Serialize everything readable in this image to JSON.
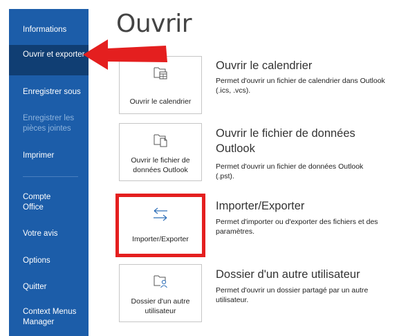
{
  "colors": {
    "sidebar_bg": "#1c5da9",
    "sidebar_selected_bg": "#103e73",
    "sidebar_disabled_text": "#8fb4dc",
    "annotation_red": "#e41f1f"
  },
  "sidebar": {
    "items": [
      {
        "label": "Informations",
        "state": "normal"
      },
      {
        "label": "Ouvrir et exporter",
        "state": "selected"
      },
      {
        "label": "Enregistrer sous",
        "state": "normal"
      },
      {
        "label": "Enregistrer les pièces jointes",
        "state": "disabled"
      },
      {
        "label": "Imprimer",
        "state": "normal"
      },
      {
        "label": "Compte Office",
        "state": "normal"
      },
      {
        "label": "Votre avis",
        "state": "normal"
      },
      {
        "label": "Options",
        "state": "normal"
      },
      {
        "label": "Quitter",
        "state": "normal"
      },
      {
        "label": "Context Menus Manager",
        "state": "normal"
      }
    ]
  },
  "main": {
    "title": "Ouvrir",
    "options": [
      {
        "tile_label": "Ouvrir le calendrier",
        "icon": "open-calendar-icon",
        "title": "Ouvrir le calendrier",
        "description": "Permet d'ouvrir un fichier de calendrier dans Outlook (.ics, .vcs)."
      },
      {
        "tile_label": "Ouvrir le fichier de données Outlook",
        "icon": "open-data-file-icon",
        "title": "Ouvrir le fichier de données Outlook",
        "description": "Permet d'ouvrir un fichier de données Outlook (.pst)."
      },
      {
        "tile_label": "Importer/Exporter",
        "icon": "import-export-icon",
        "title": "Importer/Exporter",
        "description": "Permet d'importer ou d'exporter des fichiers et des paramètres.",
        "highlighted": true
      },
      {
        "tile_label": "Dossier d'un autre utilisateur",
        "icon": "shared-folder-icon",
        "title": "Dossier d'un autre utilisateur",
        "description": "Permet d'ouvrir un dossier partagé par un autre utilisateur."
      }
    ]
  }
}
